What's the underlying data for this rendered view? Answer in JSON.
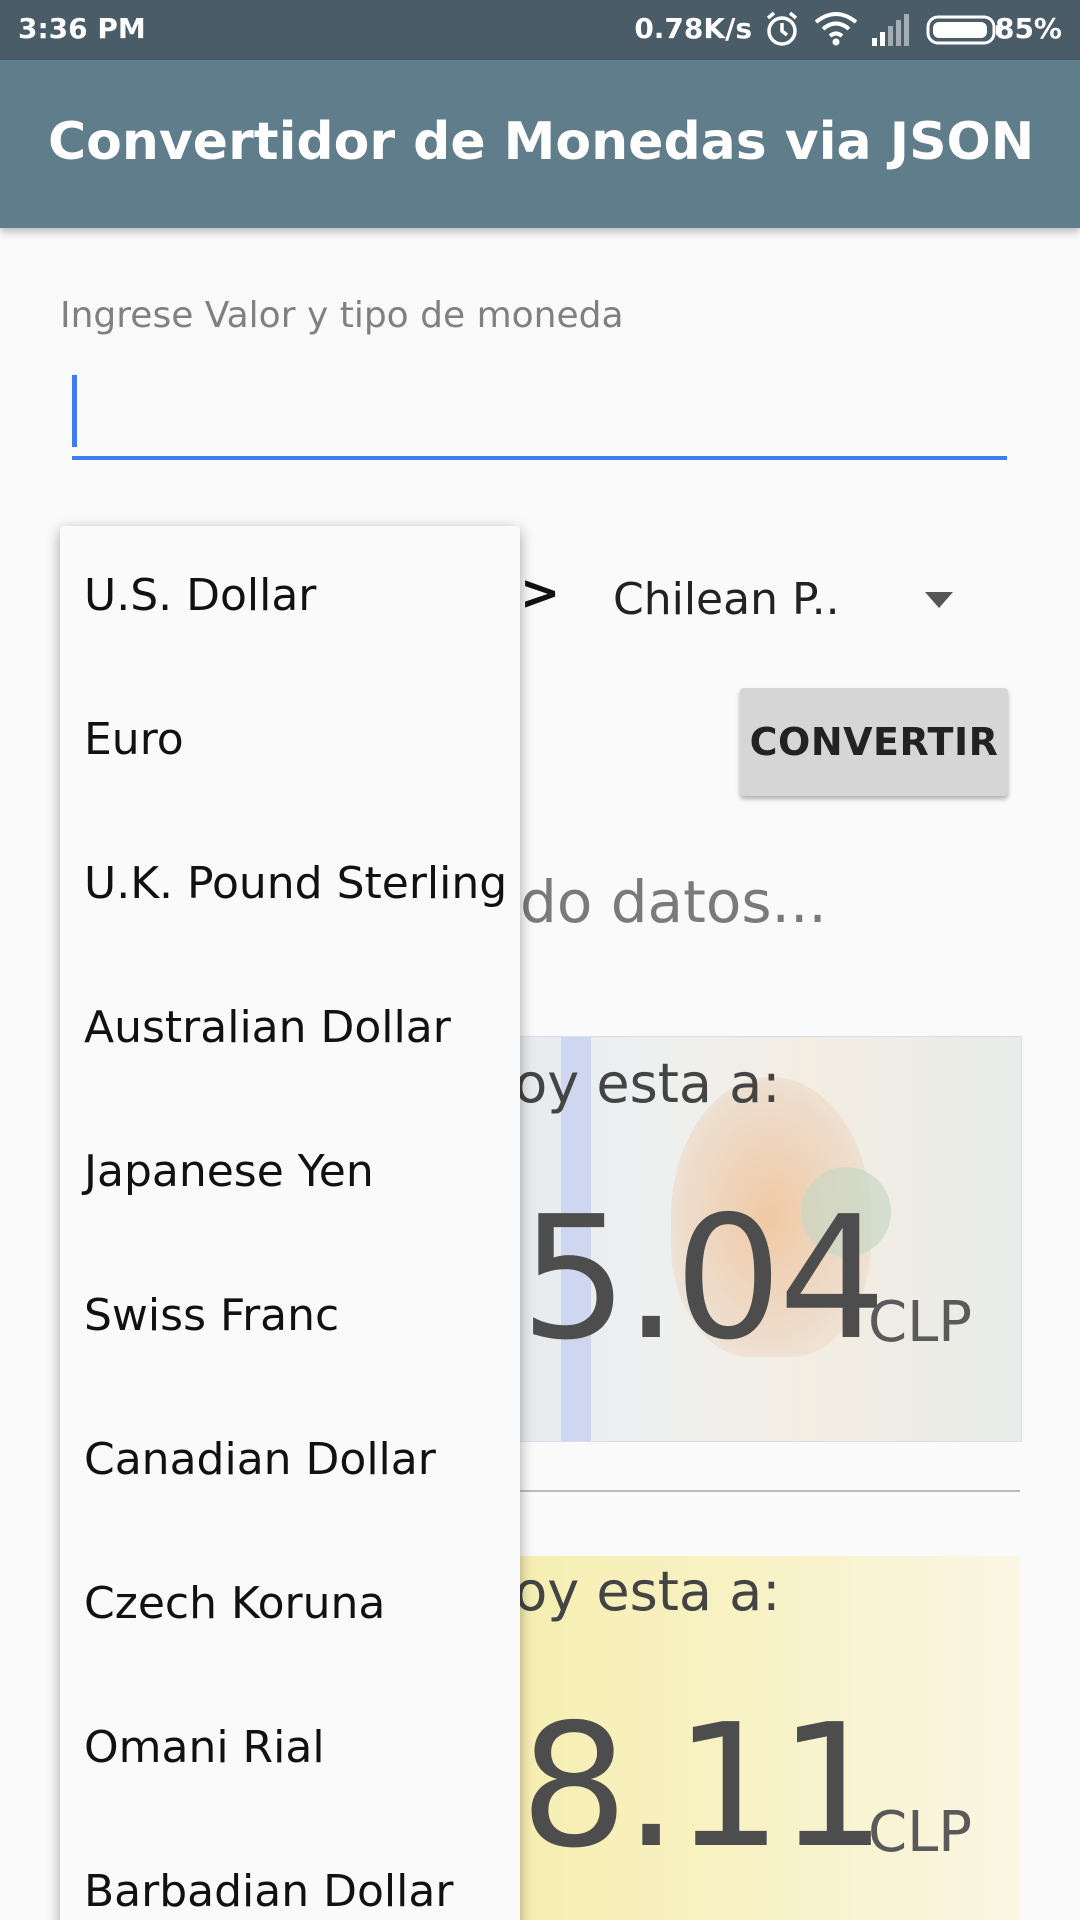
{
  "status_bar": {
    "time": "3:36 PM",
    "network_speed": "0.78K/s",
    "battery_percent": "85%",
    "icons": [
      "alarm-icon",
      "wifi-icon",
      "signal-icon",
      "battery-icon"
    ]
  },
  "app_bar": {
    "title": "Convertidor de Monedas via JSON",
    "color": "#607d8b"
  },
  "input": {
    "label": "Ingrese Valor y tipo de moneda",
    "value": "",
    "accent_color": "#3f7cf2"
  },
  "spinner_row": {
    "separator": ">",
    "to_currency": "Chilean P.."
  },
  "convert_button": {
    "label": "CONVERTIR"
  },
  "loading_text": "do datos...",
  "cards": [
    {
      "caption": "hoy esta a:",
      "value": "5.04",
      "currency": "CLP"
    },
    {
      "caption": "hoy esta a:",
      "value": "8.11",
      "currency": "CLP"
    }
  ],
  "dropdown": {
    "items": [
      "U.S. Dollar",
      "Euro",
      "U.K. Pound Sterling",
      "Australian Dollar",
      "Japanese Yen",
      "Swiss Franc",
      "Canadian Dollar",
      "Czech Koruna",
      "Omani Rial",
      "Barbadian Dollar"
    ]
  }
}
